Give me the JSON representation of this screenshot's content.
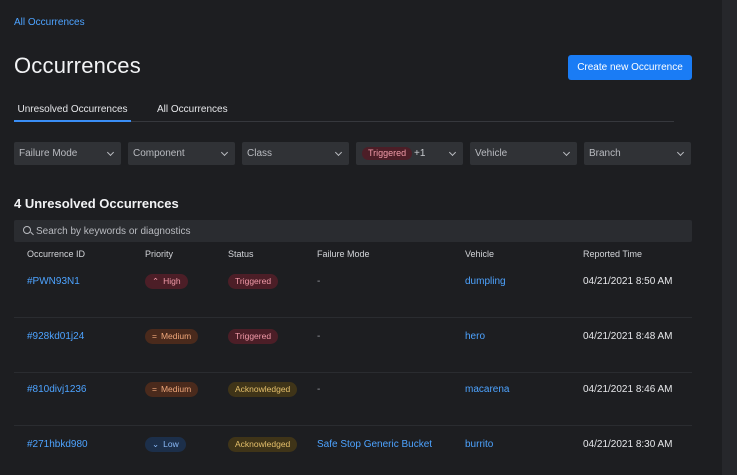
{
  "breadcrumb": "All Occurrences",
  "page_title": "Occurrences",
  "create_button": "Create new Occurrence",
  "tabs": [
    {
      "label": "Unresolved Occurrences",
      "active": true
    },
    {
      "label": "All Occurrences",
      "active": false
    }
  ],
  "filters": {
    "failure_mode": "Failure Mode",
    "component": "Component",
    "class": "Class",
    "status_chip": "Triggered",
    "status_extra": "+1",
    "vehicle": "Vehicle",
    "branch": "Branch"
  },
  "section_title": "4 Unresolved Occurrences",
  "search": {
    "placeholder": "Search by keywords or diagnostics"
  },
  "columns": [
    "Occurrence ID",
    "Priority",
    "Status",
    "Failure Mode",
    "Vehicle",
    "Reported Time"
  ],
  "rows": [
    {
      "id": "#PWN93N1",
      "priority": "High",
      "priority_icon": "chevron-up-icon",
      "status": "Triggered",
      "failure_mode": "-",
      "vehicle": "dumpling",
      "time": "04/21/2021 8:50 AM"
    },
    {
      "id": "#928kd01j24",
      "priority": "Medium",
      "priority_icon": "equals-icon",
      "status": "Triggered",
      "failure_mode": "-",
      "vehicle": "hero",
      "time": "04/21/2021 8:48 AM"
    },
    {
      "id": "#810divj1236",
      "priority": "Medium",
      "priority_icon": "equals-icon",
      "status": "Acknowledged",
      "failure_mode": "-",
      "vehicle": "macarena",
      "time": "04/21/2021 8:46 AM"
    },
    {
      "id": "#271hbkd980",
      "priority": "Low",
      "priority_icon": "chevron-down-icon",
      "status": "Acknowledged",
      "failure_mode": "Safe Stop Generic Bucket",
      "vehicle": "burrito",
      "time": "04/21/2021 8:30 AM"
    }
  ],
  "colors": {
    "accent": "#1a7cf5",
    "link": "#4da3ff",
    "background": "#1d1e21",
    "high": "#f19aa8",
    "medium": "#f0a77a",
    "low": "#8ab9f7",
    "acknowledged": "#e5c06b"
  }
}
